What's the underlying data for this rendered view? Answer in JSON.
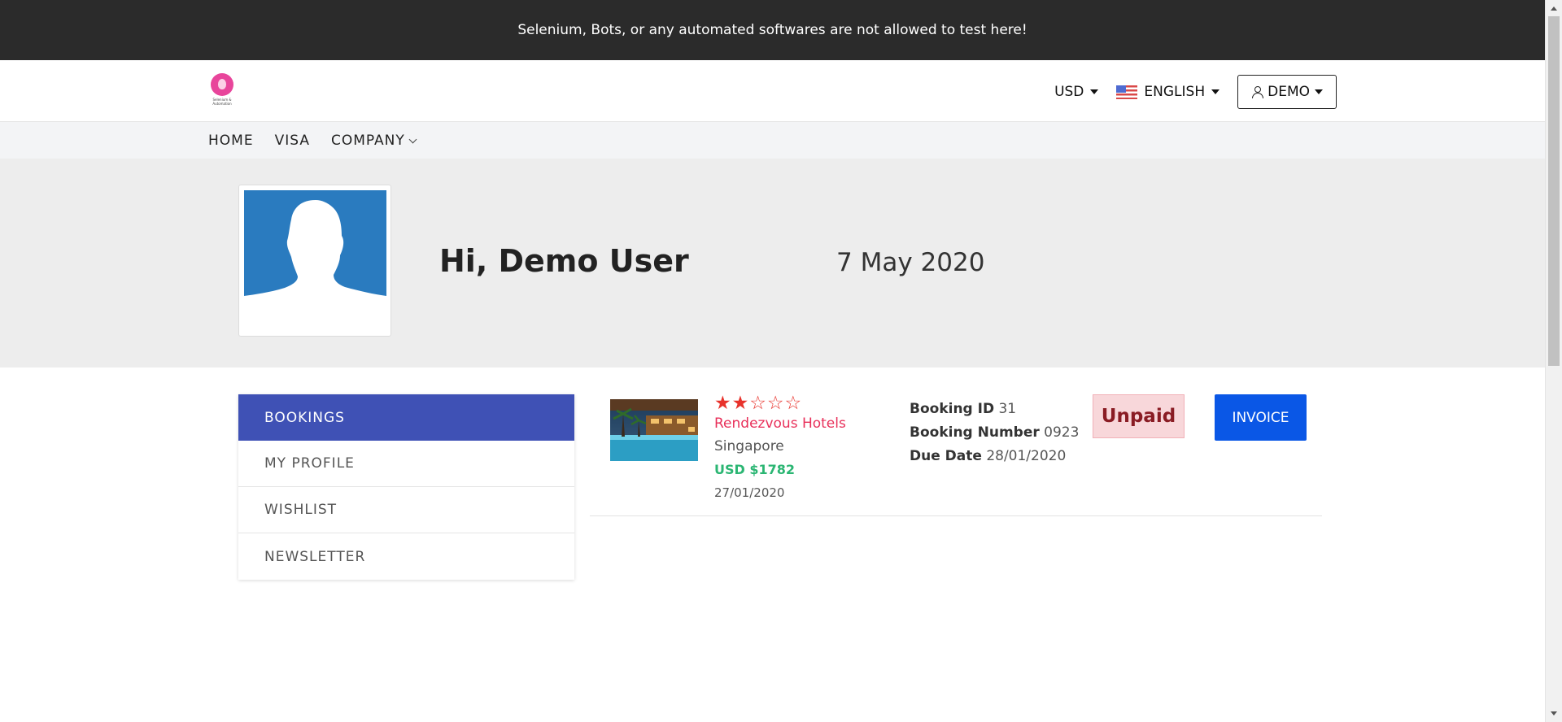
{
  "banner": {
    "text": "Selenium, Bots, or any automated softwares are not allowed to test here!"
  },
  "header": {
    "logo_tag": "Selenium & Automation",
    "currency": "USD",
    "language": "ENGLISH",
    "account": "DEMO"
  },
  "nav": {
    "items": [
      "HOME",
      "VISA",
      "COMPANY"
    ]
  },
  "profile": {
    "greeting": "Hi, Demo User",
    "date": "7 May 2020"
  },
  "sidebar": {
    "items": [
      "BOOKINGS",
      "MY PROFILE",
      "WISHLIST",
      "NEWSLETTER"
    ],
    "active": "BOOKINGS"
  },
  "booking": {
    "rating": 2,
    "rating_max": 5,
    "hotel": "Rendezvous Hotels",
    "city": "Singapore",
    "price": "USD $1782",
    "date": "27/01/2020",
    "id_label": "Booking ID",
    "id_value": "31",
    "number_label": "Booking Number",
    "number_value": "0923",
    "due_label": "Due Date",
    "due_value": "28/01/2020",
    "status": "Unpaid",
    "invoice_label": "INVOICE"
  },
  "colors": {
    "accent": "#3f51b5",
    "invoice": "#0a57e6",
    "hotel": "#e8305a",
    "price": "#2bb673",
    "banner": "#2b2b2b"
  }
}
